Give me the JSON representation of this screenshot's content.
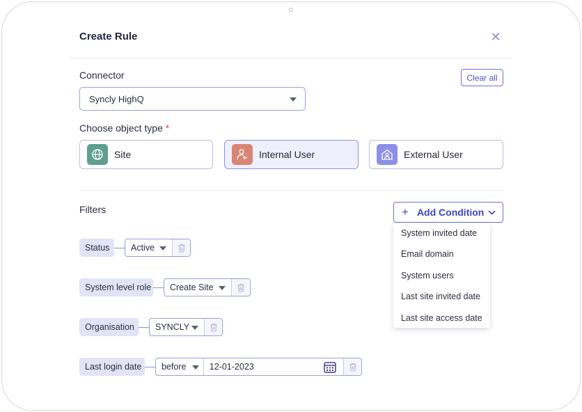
{
  "modal": {
    "title": "Create Rule",
    "close_icon": "close-icon"
  },
  "connector": {
    "label": "Connector",
    "clear_all": "Clear all",
    "selected": "Syncly HighQ"
  },
  "object_type": {
    "label": "Choose object type",
    "required_mark": "*",
    "options": [
      {
        "label": "Site",
        "icon": "globe-icon",
        "icon_color": "#5e9f8f",
        "selected": false
      },
      {
        "label": "Internal User",
        "icon": "user-arrow-icon",
        "icon_color": "#d98575",
        "selected": true
      },
      {
        "label": "External User",
        "icon": "user-home-icon",
        "icon_color": "#8b8fe6",
        "selected": false
      }
    ]
  },
  "filters": {
    "label": "Filters",
    "add_condition": "Add Condition",
    "dropdown_items": [
      "System invited date",
      "Email domain",
      "System users",
      "Last site invited date",
      "Last site access date"
    ],
    "rows": [
      {
        "name": "Status",
        "value": "Active"
      },
      {
        "name": "System level role",
        "value": "Create Site"
      },
      {
        "name": "Organisation",
        "value": "SYNCLY"
      },
      {
        "name": "Last login date",
        "operator": "before",
        "date": "12-01-2023"
      }
    ]
  },
  "colors": {
    "accent": "#4b4fd0",
    "chip_bg": "#e1e3f6",
    "selected_card_bg": "#eef0fd"
  }
}
